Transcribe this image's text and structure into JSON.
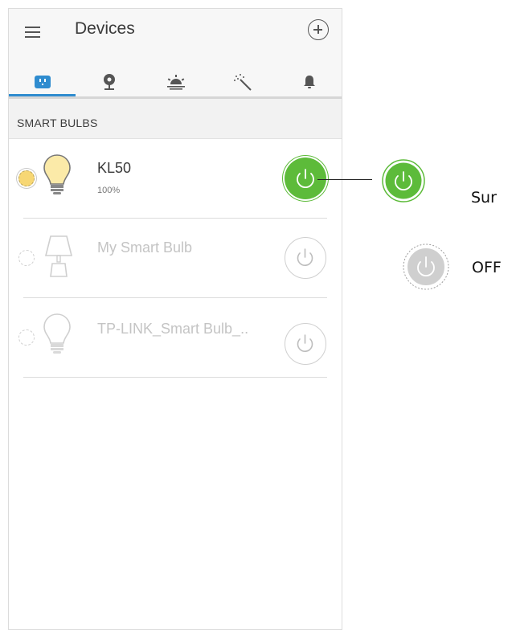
{
  "app": {
    "title": "Devices"
  },
  "tabs": [
    {
      "name": "tab-devices",
      "icon": "smart-plug-icon",
      "active": true
    },
    {
      "name": "tab-cameras",
      "icon": "camera-icon",
      "active": false
    },
    {
      "name": "tab-schedule",
      "icon": "sunrise-icon",
      "active": false
    },
    {
      "name": "tab-scenes",
      "icon": "magic-wand-icon",
      "active": false
    },
    {
      "name": "tab-notifications",
      "icon": "bell-icon",
      "active": false
    }
  ],
  "section": {
    "title": "SMART BULBS"
  },
  "devices": [
    {
      "name": "KL50",
      "status": "100%",
      "state": "on",
      "icon": "bulb-icon"
    },
    {
      "name": "My Smart Bulb",
      "status": "",
      "state": "off",
      "icon": "lamp-icon"
    },
    {
      "name": "TP-LINK_Smart Bulb_..",
      "status": "",
      "state": "off",
      "icon": "bulb-icon"
    }
  ],
  "legend": {
    "on_label": "Sur",
    "off_label": "OFF"
  },
  "colors": {
    "accent_blue": "#2f8ccf",
    "power_on_green": "#5dbb3a",
    "status_on_yellow": "#f7d774",
    "off_gray": "#cccccc"
  }
}
